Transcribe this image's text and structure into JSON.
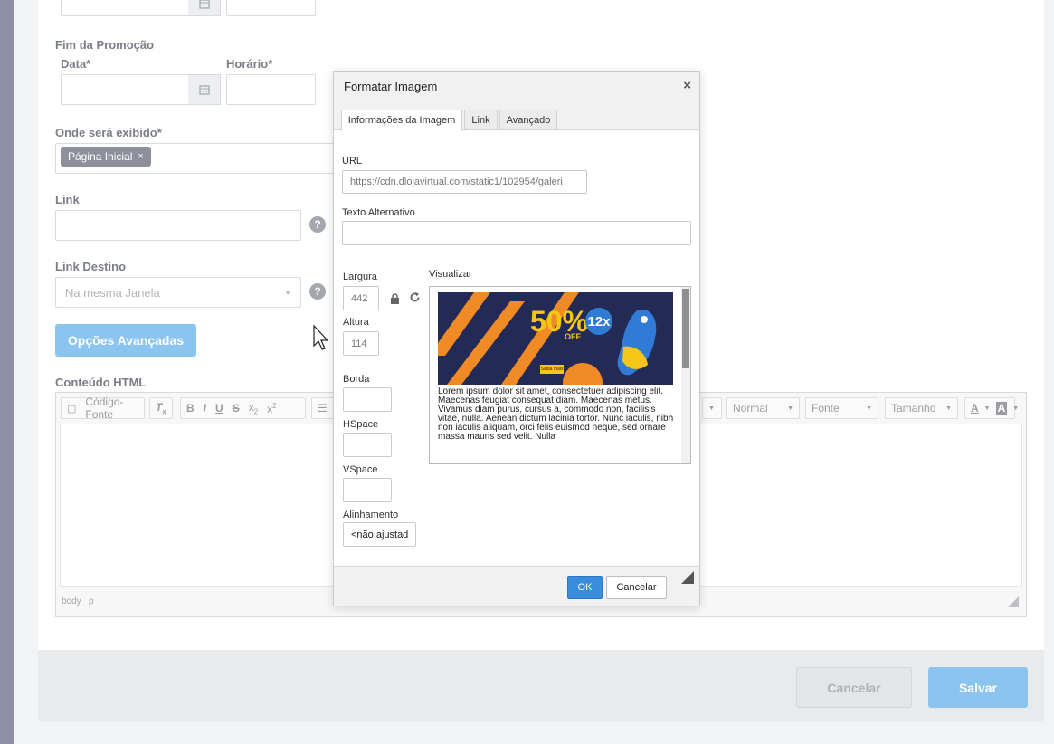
{
  "form": {
    "end_section": "Fim da Promoção",
    "date_label": "Data*",
    "time_label": "Horário*",
    "display_label": "Onde será exibido*",
    "display_tag": "Página Inicial",
    "link_label": "Link",
    "link_target_label": "Link Destino",
    "link_target_value": "Na mesma Janela",
    "advanced_button": "Opções Avançadas",
    "html_label": "Conteúdo HTML"
  },
  "editor": {
    "source_button": "Código-Fonte",
    "format_select": "Normal",
    "font_select": "Fonte",
    "size_select": "Tamanho",
    "path": [
      "body",
      "p"
    ]
  },
  "footer": {
    "cancel": "Cancelar",
    "save": "Salvar"
  },
  "dialog": {
    "title": "Formatar Imagem",
    "tabs": [
      "Informações da Imagem",
      "Link",
      "Avançado"
    ],
    "url_label": "URL",
    "url_value": "https://cdn.dlojavirtual.com/static1/102954/galeri",
    "alt_label": "Texto Alternativo",
    "alt_value": "",
    "width_label": "Largura",
    "width_value": "442",
    "height_label": "Altura",
    "height_value": "114",
    "border_label": "Borda",
    "hspace_label": "HSpace",
    "vspace_label": "VSpace",
    "align_label": "Alinhamento",
    "align_value": "<não ajustad",
    "preview_label": "Visualizar",
    "preview_text": "Lorem ipsum dolor sit amet, consectetuer adipiscing elit. Maecenas feugiat consequat diam. Maecenas metus. Vivamus diam purus, cursus a, commodo non, facilisis vitae, nulla. Aenean dictum lacinia tortor. Nunc iaculis, nibh non iaculis aliquam, orci felis euismod neque, sed ornare massa mauris sed velit. Nulla",
    "banner": {
      "discount": "50%",
      "off": "OFF",
      "installments": "12x",
      "cta": "Saiba mais"
    },
    "ok": "OK",
    "cancel": "Cancelar"
  }
}
